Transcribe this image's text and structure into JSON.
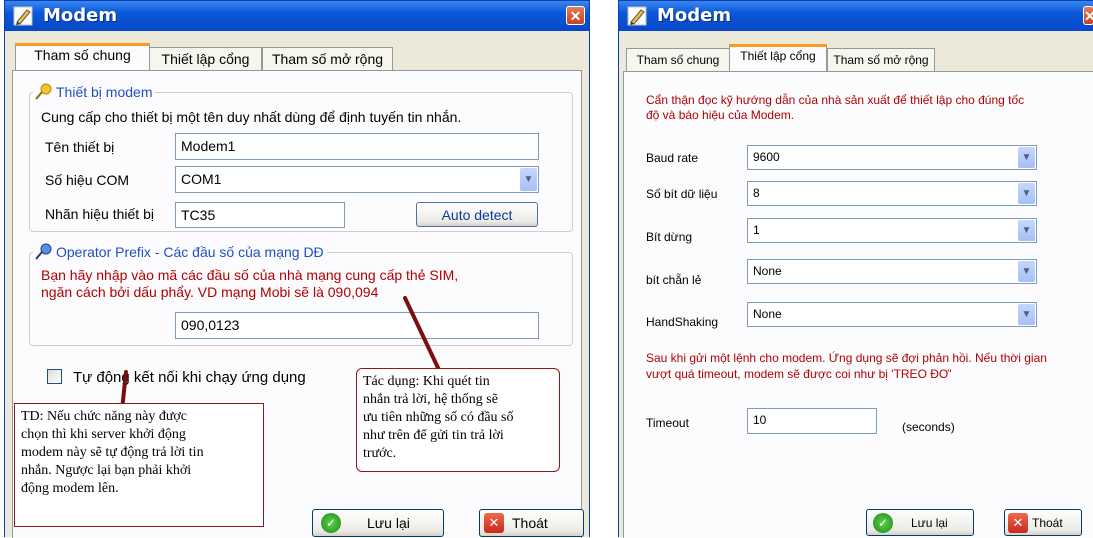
{
  "left": {
    "title": "Modem",
    "close": "✕",
    "tabs": [
      "Tham số chung",
      "Thiết lập cổng",
      "Tham số mở rộng"
    ],
    "device_group": {
      "title": "Thiết bị modem",
      "description": "Cung cấp cho thiết bị một tên duy nhất dùng để định tuyến tin nhắn.",
      "name_label": "Tên thiết bị",
      "name_value": "Modem1",
      "com_label": "Số hiệu COM",
      "com_value": "COM1",
      "brand_label": "Nhãn hiệu thiết bị",
      "brand_value": "TC35",
      "auto_detect": "Auto detect"
    },
    "operator_group": {
      "title": "Operator Prefix - Các đầu số của mạng DĐ",
      "line1": "Bạn hãy nhập vào mã các đầu số của nhà mạng cung cấp thẻ SIM,",
      "line2": "ngăn cách bởi dấu phẩy. VD mạng Mobi sẽ là 090,094",
      "prefix_value": "090,0123"
    },
    "auto_connect_label": "Tự động kết nối khi chạy ứng dụng",
    "save": "Lưu lại",
    "exit": "Thoát"
  },
  "notes": {
    "left": [
      "TD: Nếu chức năng này được",
      "chọn thì khi server khởi động",
      "modem này sẽ tự động trả lời tin",
      "nhắn. Ngược lại bạn phải khởi",
      "động modem lên."
    ],
    "right": [
      "Tác dụng: Khi quét tin",
      "nhắn trả lời, hệ thống sẽ",
      "ưu tiên những số có đầu số",
      "như trên để gửi tin trả lời",
      "trước."
    ]
  },
  "right": {
    "title": "Modem",
    "close": "✕",
    "tabs": [
      "Tham số chung",
      "Thiết lập cổng",
      "Tham số mở rộng"
    ],
    "intro1": "Cẩn thận đọc kỹ hướng dẫn của nhà sản xuất để thiết lập cho đúng tốc",
    "intro2": "độ và báo hiệu của Modem.",
    "baud_label": "Baud rate",
    "baud_value": "9600",
    "databits_label": "Số bít dữ liệu",
    "databits_value": "8",
    "stopbits_label": "Bít dừng",
    "stopbits_value": "1",
    "parity_label": "bít chẵn lẻ",
    "parity_value": "None",
    "handshake_label": "HandShaking",
    "handshake_value": "None",
    "warn1": "Sau khi gửi một lệnh cho modem. Ứng dụng sẽ đợi phản hồi. Nếu thời gian",
    "warn2": "vượt quá timeout, modem sẽ được coi như bị 'TREO ĐƠ'",
    "timeout_label": "Timeout",
    "timeout_value": "10",
    "timeout_unit": "(seconds)",
    "save": "Lưu lại",
    "exit": "Thoát"
  }
}
